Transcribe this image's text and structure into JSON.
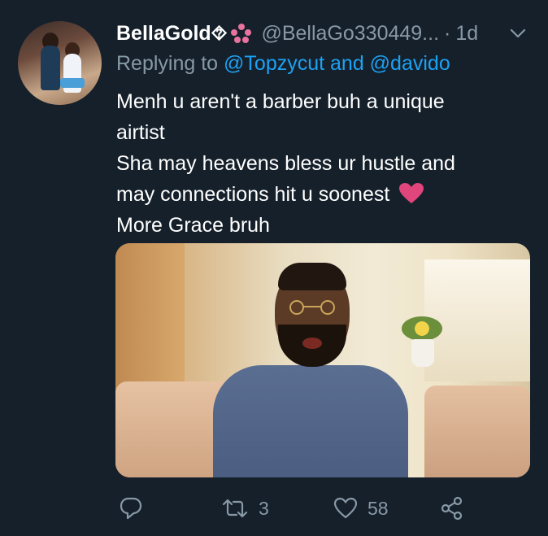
{
  "tweet": {
    "display_name": "BellaGold⯑",
    "handle": "@BellaGo330449...",
    "separator": "·",
    "time": "1d",
    "replying_prefix": "Replying to ",
    "replying_to": "@Topzycut and @davido",
    "text_lines": [
      "Menh u  aren't a barber buh a unique",
      "airtist",
      "Sha may heavens bless ur hustle and",
      "may connections hit u soonest",
      "More Grace bruh"
    ],
    "heart_emoji_color": "#e0457b"
  },
  "actions": {
    "reply_icon": "reply-icon",
    "retweet_icon": "retweet-icon",
    "retweet_count": "3",
    "like_icon": "heart-icon",
    "like_count": "58",
    "share_icon": "share-icon"
  },
  "colors": {
    "background": "#15202b",
    "text_primary": "#ffffff",
    "text_secondary": "#8899a6",
    "link": "#1da1f2"
  }
}
